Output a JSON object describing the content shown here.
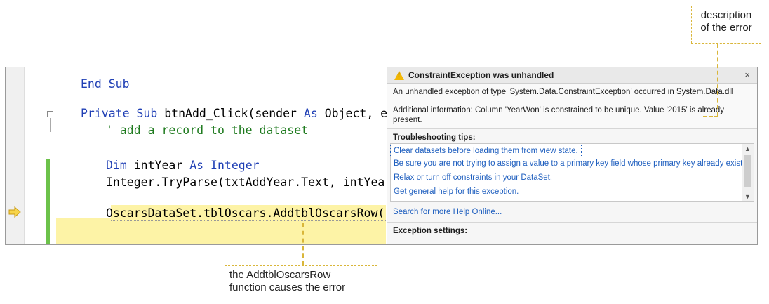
{
  "callouts": {
    "description": "description\nof the error",
    "function": "the AddtblOscarsRow\nfunction causes the error"
  },
  "code": {
    "line_end_sub": "End Sub",
    "line_private": "Private Sub btnAdd_Click(sender As Object, e",
    "line_comment": "' add a record to the dataset",
    "line_dim": "Dim intYear As Integer",
    "line_tryparse": "Integer.TryParse(txtAddYear.Text, intYea",
    "line_oscars": "OscarsDataSet.tblOscars.AddtblOscarsRow("
  },
  "exception": {
    "title": "ConstraintException was unhandled",
    "close": "×",
    "message": "An unhandled exception of type 'System.Data.ConstraintException' occurred in System.Data.dll",
    "additional": "Additional information: Column 'YearWon' is constrained to be unique.  Value '2015' is already present.",
    "tips_title": "Troubleshooting tips:",
    "tips": [
      "Clear datasets before loading them from view state.",
      "Be sure you are not trying to assign a value to a primary key field whose primary key already exists.",
      "Relax or turn off constraints in your DataSet.",
      "Get general help for this exception."
    ],
    "help_link": "Search for more Help Online...",
    "settings_title": "Exception settings:"
  },
  "colors": {
    "keyword": "#1f3fb5",
    "comment": "#1e7a1e",
    "type": "#2b91af",
    "highlight": "#fdf3a6",
    "callout_border": "#d9b63a",
    "link": "#1f5fbf"
  }
}
